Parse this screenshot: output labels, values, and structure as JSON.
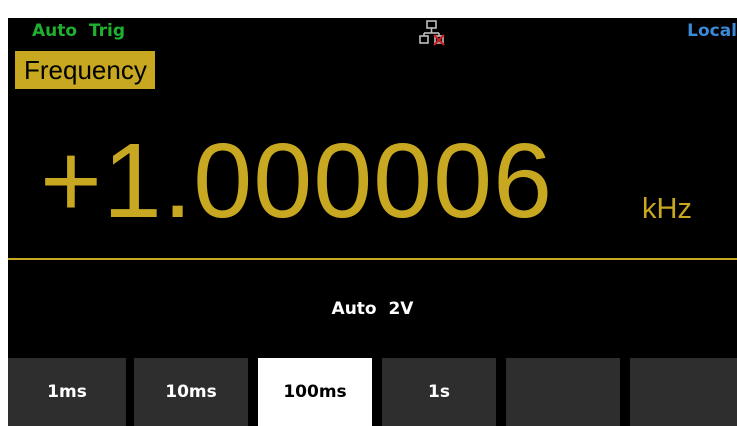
{
  "status_bar": {
    "trigger": "Auto  Trig",
    "network_icon": "network-disconnected-icon",
    "remote": "Local"
  },
  "measurement": {
    "function": "Frequency",
    "reading": "+1.000006",
    "unit": "kHz",
    "range_info": "Auto  2V"
  },
  "softkeys": [
    {
      "label": "1ms",
      "selected": false
    },
    {
      "label": "10ms",
      "selected": false
    },
    {
      "label": "100ms",
      "selected": true
    },
    {
      "label": "1s",
      "selected": false
    },
    {
      "label": "",
      "selected": false
    },
    {
      "label": "",
      "selected": false
    }
  ],
  "colors": {
    "background": "#000000",
    "accent": "#c8a820",
    "trigger_text": "#20b030",
    "remote_text": "#3a8ad8",
    "softkey": "#2e2e2e",
    "softkey_selected": "#ffffff"
  }
}
